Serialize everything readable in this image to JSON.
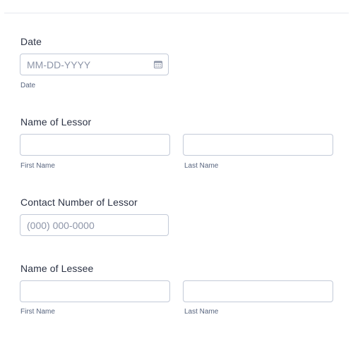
{
  "form": {
    "date": {
      "label": "Date",
      "placeholder": "MM-DD-YYYY",
      "sublabel": "Date"
    },
    "lessor_name": {
      "label": "Name of Lessor",
      "first_sublabel": "First Name",
      "last_sublabel": "Last Name"
    },
    "lessor_contact": {
      "label": "Contact Number of Lessor",
      "placeholder": "(000) 000-0000"
    },
    "lessee_name": {
      "label": "Name of Lessee",
      "first_sublabel": "First Name",
      "last_sublabel": "Last Name"
    }
  },
  "icons": {
    "date_picker": "calendar-icon"
  },
  "colors": {
    "border": "#c3cad8",
    "label": "#2c3345",
    "sublabel": "#57647e",
    "placeholder": "#8d95a8"
  }
}
